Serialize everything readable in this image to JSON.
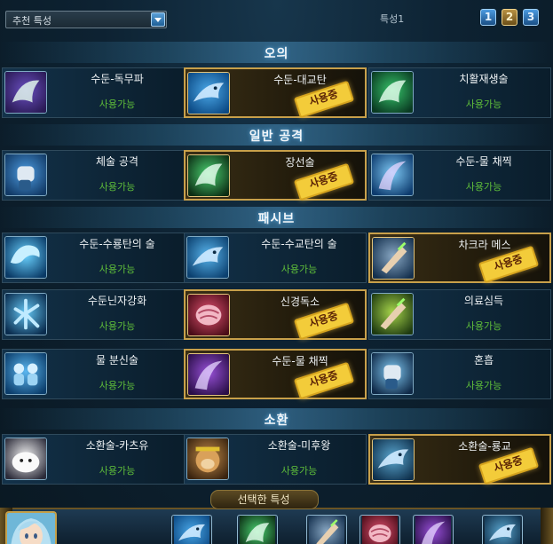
{
  "topbar": {
    "dropdown_label": "추천 특성",
    "page_label": "특성1",
    "pages": [
      "1",
      "2",
      "3"
    ]
  },
  "sections": [
    {
      "title": "오의",
      "skills": [
        {
          "name": "수둔-독무파",
          "status": "사용가능",
          "active": false,
          "icon": "poison-mist-icon"
        },
        {
          "name": "수둔-대교탄",
          "status": "",
          "active": true,
          "badge": "사용중",
          "icon": "water-shark-icon"
        },
        {
          "name": "치활재생술",
          "status": "사용가능",
          "active": false,
          "icon": "healing-hand-icon"
        }
      ]
    },
    {
      "title": "일반 공격",
      "skills": [
        {
          "name": "체술 공격",
          "status": "사용가능",
          "active": false,
          "icon": "fist-icon"
        },
        {
          "name": "장선술",
          "status": "",
          "active": true,
          "badge": "사용중",
          "icon": "green-palm-icon"
        },
        {
          "name": "수둔-물 채찍",
          "status": "사용가능",
          "active": false,
          "icon": "water-whip-icon"
        }
      ]
    },
    {
      "title": "패시브",
      "skills": [
        {
          "name": "수둔-수룡탄의 술",
          "status": "사용가능",
          "active": false,
          "icon": "water-dragon-icon"
        },
        {
          "name": "수둔-수교탄의 술",
          "status": "사용가능",
          "active": false,
          "icon": "water-shark-small-icon"
        },
        {
          "name": "차크라 메스",
          "status": "",
          "active": true,
          "badge": "사용중",
          "icon": "chakra-scalpel-icon"
        },
        {
          "name": "수둔닌자강화",
          "status": "사용가능",
          "active": false,
          "icon": "water-kanji-icon"
        },
        {
          "name": "신경독소",
          "status": "",
          "active": true,
          "badge": "사용중",
          "icon": "brain-toxin-icon"
        },
        {
          "name": "의료심득",
          "status": "사용가능",
          "active": false,
          "icon": "medical-hand-icon"
        },
        {
          "name": "물 분신술",
          "status": "사용가능",
          "active": false,
          "icon": "water-clone-icon"
        },
        {
          "name": "수둔-물 채찍",
          "status": "",
          "active": true,
          "badge": "사용중",
          "icon": "purple-whip-icon"
        },
        {
          "name": "혼흡",
          "status": "사용가능",
          "active": false,
          "icon": "glowing-fist-icon"
        }
      ]
    },
    {
      "title": "소환",
      "skills": [
        {
          "name": "소환술-카츠유",
          "status": "사용가능",
          "active": false,
          "icon": "katsuyu-icon"
        },
        {
          "name": "소환술-미후왕",
          "status": "사용가능",
          "active": false,
          "icon": "monkey-king-icon"
        },
        {
          "name": "소환술-룡교",
          "status": "",
          "active": true,
          "badge": "사용중",
          "icon": "dragon-shark-icon"
        }
      ]
    }
  ],
  "bottom": {
    "title": "선택한 특성",
    "selected_icons": [
      "water-shark-icon",
      "green-palm-icon",
      "chakra-scalpel-icon",
      "brain-toxin-icon",
      "purple-whip-icon",
      "dragon-shark-icon"
    ]
  },
  "colors": {
    "available": "#5fbf3a",
    "badge": "#f3cc3a",
    "badge_text": "#5a2306",
    "gold_border": "#c8a04a"
  }
}
